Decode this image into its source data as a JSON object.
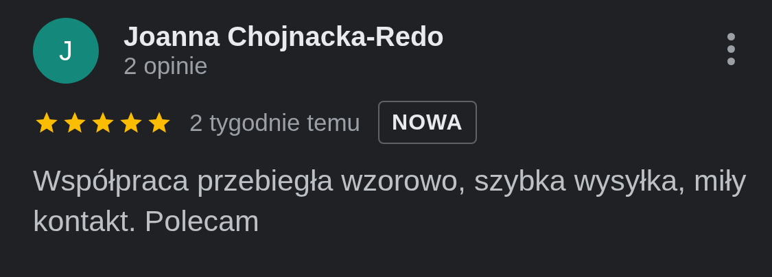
{
  "review": {
    "avatar": {
      "letter": "J",
      "color": "#14897b"
    },
    "author": "Joanna Chojnacka-Redo",
    "review_count": "2 opinie",
    "stars": 5,
    "time": "2 tygodnie temu",
    "badge": "NOWA",
    "text": "Współpraca przebiegła wzorowo, szybka wysyłka, miły kontakt. Polecam"
  }
}
